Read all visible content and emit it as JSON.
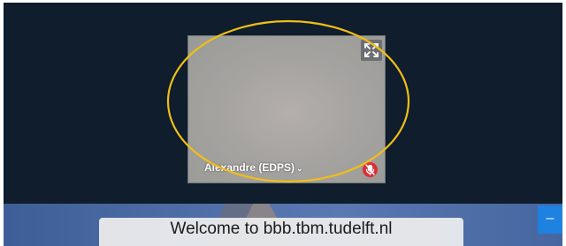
{
  "video": {
    "participant_name": "Alexandre (EDPS)",
    "name_chevron": "⌄",
    "fullscreen_icon": "fullscreen-icon",
    "mute_icon": "muted-microphone-icon"
  },
  "presentation": {
    "welcome_title": "Welcome to bbb.tbm.tudelft.nl"
  },
  "side_panel": {
    "collapse_label": "–"
  },
  "colors": {
    "background": "#0f1d2c",
    "annotation": "#f1be16",
    "mute_red": "#dc2e38",
    "action_blue": "#1f81e0"
  }
}
